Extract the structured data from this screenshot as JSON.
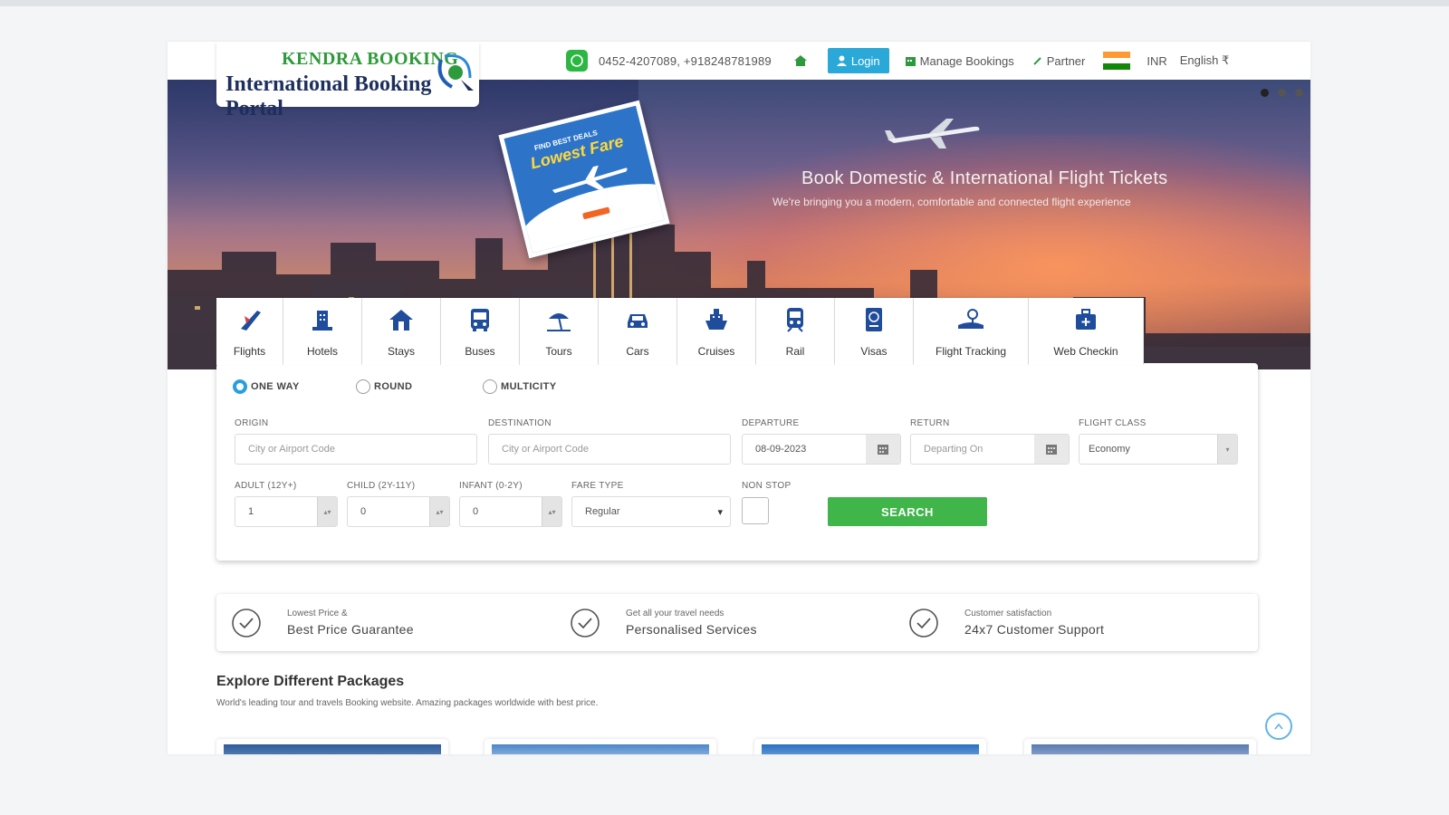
{
  "header": {
    "brand_line1": "KENDRA BOOKING",
    "brand_line2": "International Booking Portal",
    "phone": "0452-4207089, +918248781989",
    "login_label": "Login",
    "manage_bookings": "Manage Bookings",
    "partner": "Partner",
    "currency": "INR",
    "language": "English ₹"
  },
  "hero": {
    "title": "Book Domestic & International Flight Tickets",
    "subtitle": "We're bringing you a modern, comfortable and connected flight experience",
    "promo_small": "FIND BEST DEALS",
    "promo_big": "Lowest Fare",
    "slides": 3,
    "active_slide": 1
  },
  "tabs": [
    {
      "label": "Flights",
      "icon": "plane-icon"
    },
    {
      "label": "Hotels",
      "icon": "hotel-icon"
    },
    {
      "label": "Stays",
      "icon": "home-icon"
    },
    {
      "label": "Buses",
      "icon": "bus-icon"
    },
    {
      "label": "Tours",
      "icon": "beach-icon"
    },
    {
      "label": "Cars",
      "icon": "car-icon"
    },
    {
      "label": "Cruises",
      "icon": "ship-icon"
    },
    {
      "label": "Rail",
      "icon": "train-icon"
    },
    {
      "label": "Visas",
      "icon": "passport-icon"
    },
    {
      "label": "Flight Tracking",
      "icon": "tracking-icon"
    },
    {
      "label": "Web Checkin",
      "icon": "briefcase-icon"
    }
  ],
  "search": {
    "trip_types": [
      "ONE WAY",
      "ROUND",
      "MULTICITY"
    ],
    "selected_trip": "ONE WAY",
    "origin_label": "ORIGIN",
    "origin_placeholder": "City or Airport Code",
    "destination_label": "DESTINATION",
    "destination_placeholder": "City or Airport Code",
    "departure_label": "DEPARTURE",
    "departure_value": "08-09-2023",
    "return_label": "RETURN",
    "return_placeholder": "Departing On",
    "class_label": "FLIGHT CLASS",
    "class_value": "Economy",
    "adult_label": "ADULT (12Y+)",
    "adult_value": "1",
    "child_label": "CHILD (2Y-11Y)",
    "child_value": "0",
    "infant_label": "INFANT (0-2Y)",
    "infant_value": "0",
    "fare_label": "FARE TYPE",
    "fare_value": "Regular",
    "nonstop_label": "NON STOP",
    "search_label": "SEARCH"
  },
  "features": [
    {
      "small": "Lowest Price &",
      "main": "Best Price Guarantee"
    },
    {
      "small": "Get all your travel needs",
      "main": "Personalised Services"
    },
    {
      "small": "Customer satisfaction",
      "main": "24x7 Customer Support"
    }
  ],
  "explore": {
    "title": "Explore Different Packages",
    "subtitle": "World's leading tour and travels Booking website. Amazing packages worldwide with best price."
  },
  "colors": {
    "accent": "#2aa8d8",
    "search_button": "#3fb54a",
    "brand_green": "#2f9a3a",
    "brand_navy": "#1d2f5e"
  }
}
